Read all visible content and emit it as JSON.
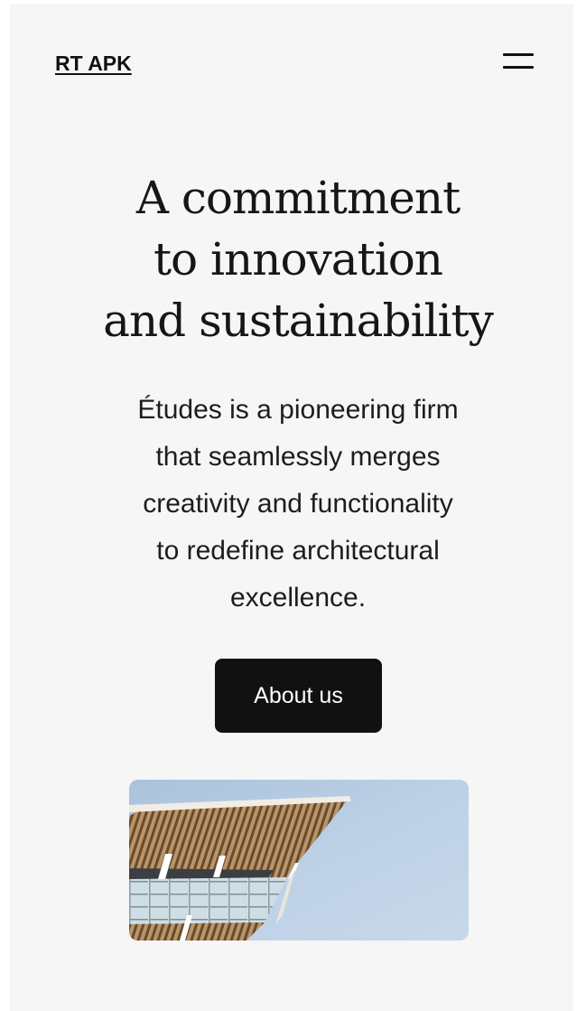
{
  "header": {
    "site_title": "RT APK",
    "menu_icon": "hamburger-menu-icon"
  },
  "hero": {
    "heading_lines": [
      "A commitment",
      "to innovation",
      "and sustainability"
    ],
    "description_lines": [
      "Études is a pioneering firm",
      "that seamlessly merges",
      "creativity and functionality",
      "to redefine architectural",
      "excellence."
    ],
    "cta_label": "About us"
  },
  "colors": {
    "background": "#f6f6f7",
    "text": "#111111",
    "button_bg": "#111111",
    "button_text": "#ffffff"
  }
}
